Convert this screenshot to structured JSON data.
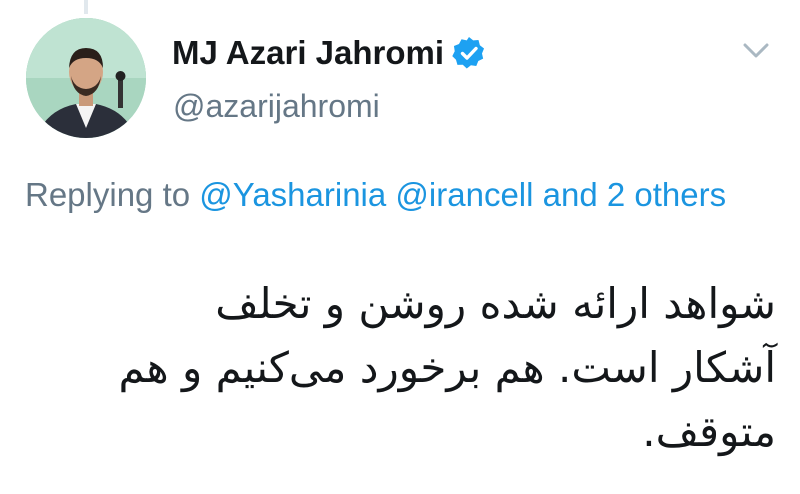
{
  "tweet": {
    "author": {
      "display_name": "MJ Azari Jahromi",
      "handle": "@azarijahromi",
      "verified": true,
      "avatar_icon": "profile-photo"
    },
    "reply_context": {
      "prefix": "Replying to ",
      "mentions": [
        "@Yasharinia",
        "@irancell"
      ],
      "joiner": " and ",
      "others": "2 others"
    },
    "text_lines": [
      "شواهد ارائه شده روشن و تخلف",
      "آشکار است. هم برخورد می‌کنیم و هم",
      "متوقف."
    ],
    "menu_icon": "chevron-down-icon"
  },
  "colors": {
    "text_primary": "#14171a",
    "text_secondary": "#657786",
    "link": "#1b95e0",
    "verified_badge": "#1da1f2",
    "chevron": "#aab8c2",
    "background": "#ffffff"
  }
}
